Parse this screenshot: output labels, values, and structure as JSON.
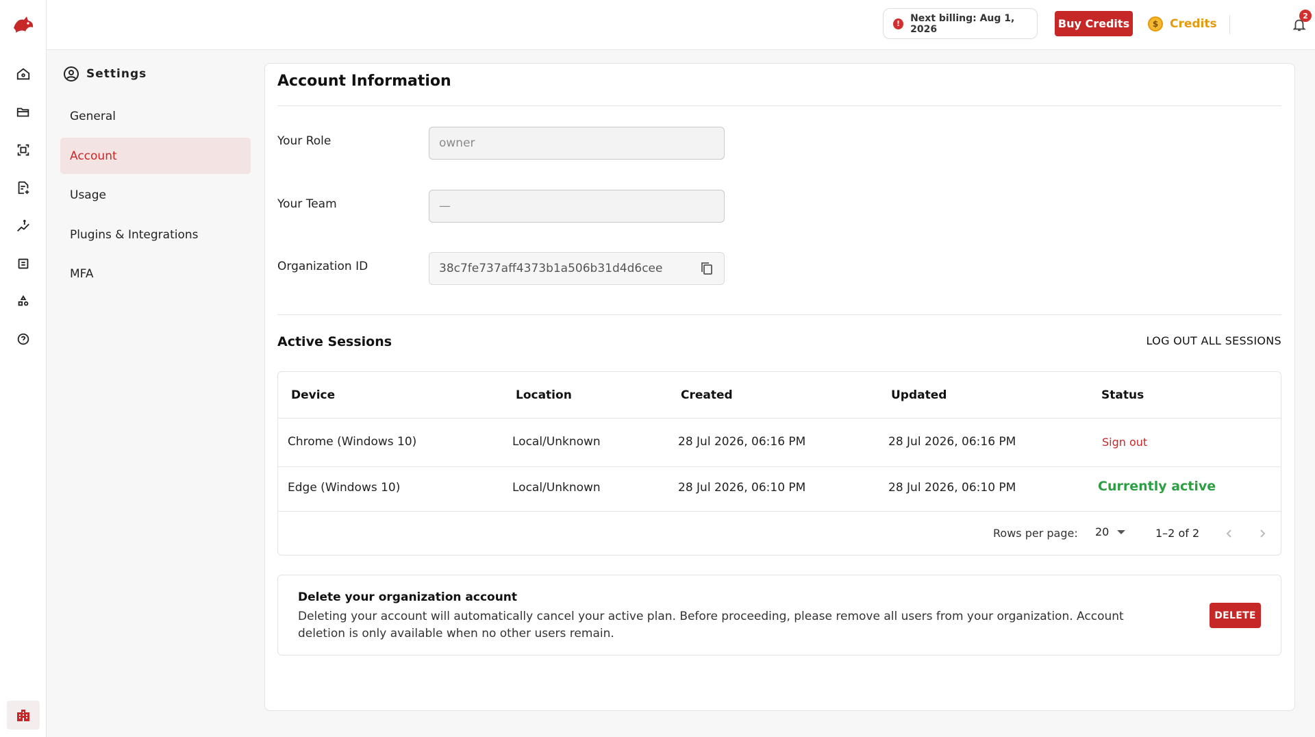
{
  "colors": {
    "accent": "#c62828",
    "active_bg": "#f3e3e3",
    "success": "#2e9e43",
    "credits": "#e59a0e"
  },
  "rail": {
    "icons": [
      "logo-icon",
      "home-icon",
      "folder-icon",
      "scan-icon",
      "document-add-icon",
      "billing-icon",
      "calculator-icon",
      "shapes-icon",
      "help-circle-icon",
      "organization-icon"
    ]
  },
  "topbar": {
    "billing_icon": "!",
    "billing_text": "Next billing: Aug 1, 2026",
    "buy_credits": "Buy Credits",
    "credits_icon": "$",
    "credits_label": "Credits",
    "notification_count": "2"
  },
  "settings": {
    "title": "Settings",
    "nav": [
      {
        "label": "General"
      },
      {
        "label": "Account",
        "active": true
      },
      {
        "label": "Usage"
      },
      {
        "label": "Plugins & Integrations"
      },
      {
        "label": "MFA"
      }
    ]
  },
  "account": {
    "heading": "Account Information",
    "role_label": "Your Role",
    "role_value": "owner",
    "team_label": "Your Team",
    "team_value": "—",
    "org_label": "Organization ID",
    "org_value": "38c7fe737aff4373b1a506b31d4d6cee"
  },
  "sessions": {
    "heading": "Active Sessions",
    "logout_all": "LOG OUT ALL SESSIONS",
    "columns": [
      "Device",
      "Location",
      "Created",
      "Updated",
      "Status"
    ],
    "rows": [
      {
        "device": "Chrome (Windows 10)",
        "location": "Local/Unknown",
        "created": "28 Jul 2026, 06:16 PM",
        "updated": "28 Jul 2026, 06:16 PM",
        "status": "Sign out"
      },
      {
        "device": "Edge (Windows 10)",
        "location": "Local/Unknown",
        "created": "28 Jul 2026, 06:10 PM",
        "updated": "28 Jul 2026, 06:10 PM",
        "status": "Currently active"
      }
    ],
    "rows_per_page_label": "Rows per page:",
    "rows_per_page_value": "20",
    "range": "1–2 of 2"
  },
  "danger": {
    "title": "Delete your organization account",
    "description": "Deleting your account will automatically cancel your active plan. Before proceeding, please remove all users from your organization. Account deletion is only available when no other users remain.",
    "delete_label": "DELETE"
  }
}
